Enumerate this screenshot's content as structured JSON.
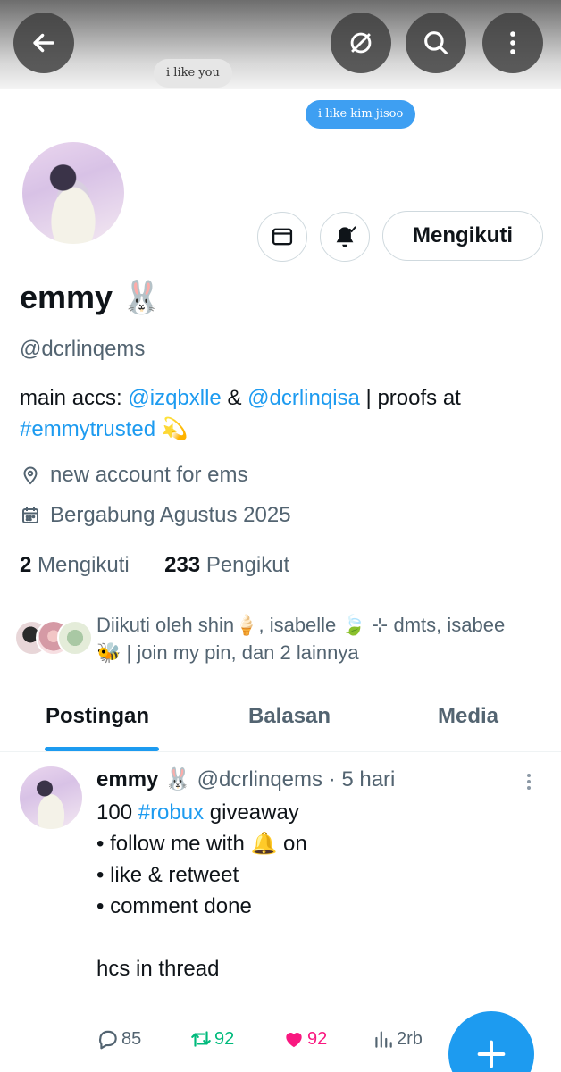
{
  "header": {
    "back_icon": "arrow-left-icon",
    "actions": [
      "hide-icon",
      "search-icon",
      "more-vertical-icon"
    ]
  },
  "banner": {
    "bubble_left": "i like you",
    "bubble_right": "i like kim jisoo"
  },
  "profile": {
    "name": "emmy",
    "name_emoji": "🐰",
    "handle": "@dcrlinqems",
    "bio": {
      "prefix": "main accs: ",
      "mention1": "@izqbxlle",
      "amp": " & ",
      "mention2": "@dcrlinqisa",
      "middle": " | proofs at",
      "hashtag": "#emmytrusted",
      "emoji": "💫"
    },
    "location": "new account for ems",
    "joined": "Bergabung Agustus 2025",
    "following_count": "2",
    "following_label": "Mengikuti",
    "followers_count": "233",
    "followers_label": "Pengikut",
    "follow_button": "Mengikuti"
  },
  "followed_by": {
    "text_line1": "Diikuti oleh shin🍦, isabelle 🍃 ⊹ dmts, isabee",
    "text_line2": "🐝 | join my pin, dan 2 lainnya"
  },
  "tabs": [
    {
      "label": "Postingan",
      "active": true
    },
    {
      "label": "Balasan",
      "active": false
    },
    {
      "label": "Media",
      "active": false
    }
  ],
  "post": {
    "author": "emmy",
    "author_emoji": "🐰",
    "handle": "@dcrlinqems",
    "time": "· 5 hari",
    "line1_prefix": "100 ",
    "line1_hashtag": "#robux",
    "line1_suffix": " giveaway",
    "body_rest": "\n• follow me with 🔔 on\n• like & retweet\n• comment done\n\nhcs in thread",
    "replies": "85",
    "reposts": "92",
    "likes": "92",
    "views": "2rb"
  },
  "colors": {
    "accent": "#1d9bf0",
    "repost": "#00ba7c",
    "like": "#f91880",
    "secondary_text": "#536471"
  }
}
